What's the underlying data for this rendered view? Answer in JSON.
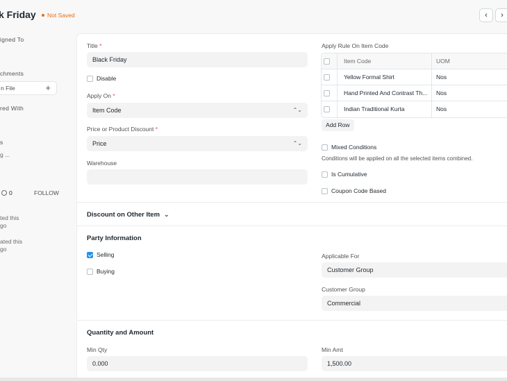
{
  "header": {
    "title": "k Friday",
    "status": "Not Saved",
    "prev_icon": "chevron-left-icon",
    "next_icon": "chevron-right-icon"
  },
  "sidebar": {
    "assigned_to": "igned To",
    "attachments": "chments",
    "attach_file": "n File",
    "shared_with": "red With",
    "tags": "s",
    "tag_item": "g ...",
    "comment_count": "0",
    "follow": "FOLLOW",
    "activity_1_line1": "ted this",
    "activity_1_line2": "go",
    "activity_2_line1": "ated this",
    "activity_2_line2": "go"
  },
  "form": {
    "title_label": "Title",
    "title_value": "Black Friday",
    "disable_label": "Disable",
    "apply_on_label": "Apply On",
    "apply_on_value": "Item Code",
    "price_discount_label": "Price or Product Discount",
    "price_discount_value": "Price",
    "warehouse_label": "Warehouse",
    "warehouse_value": "",
    "apply_rule_label": "Apply Rule On Item Code",
    "grid_headers": [
      "Item Code",
      "UOM"
    ],
    "grid_rows": [
      {
        "item": "Yellow Formal Shirt",
        "uom": "Nos"
      },
      {
        "item": "Hand Printed And Contrast Th...",
        "uom": "Nos"
      },
      {
        "item": "Indian Traditional Kurta",
        "uom": "Nos"
      }
    ],
    "add_row": "Add Row",
    "mixed_conditions_label": "Mixed Conditions",
    "mixed_conditions_desc": "Conditions will be applied on all the selected items combined.",
    "is_cumulative_label": "Is Cumulative",
    "coupon_code_label": "Coupon Code Based"
  },
  "sections": {
    "discount_other": "Discount on Other Item",
    "party_info": "Party Information",
    "qty_amount": "Quantity and Amount"
  },
  "party": {
    "selling_label": "Selling",
    "selling_checked": true,
    "buying_label": "Buying",
    "buying_checked": false,
    "applicable_for_label": "Applicable For",
    "applicable_for_value": "Customer Group",
    "customer_group_label": "Customer Group",
    "customer_group_value": "Commercial"
  },
  "qty": {
    "min_qty_label": "Min Qty",
    "min_qty_value": "0.000",
    "min_amt_label": "Min Amt",
    "min_amt_value": "1,500.00"
  },
  "colors": {
    "accent": "#2490ef",
    "status": "#e86c13",
    "required": "#e24c4c"
  }
}
